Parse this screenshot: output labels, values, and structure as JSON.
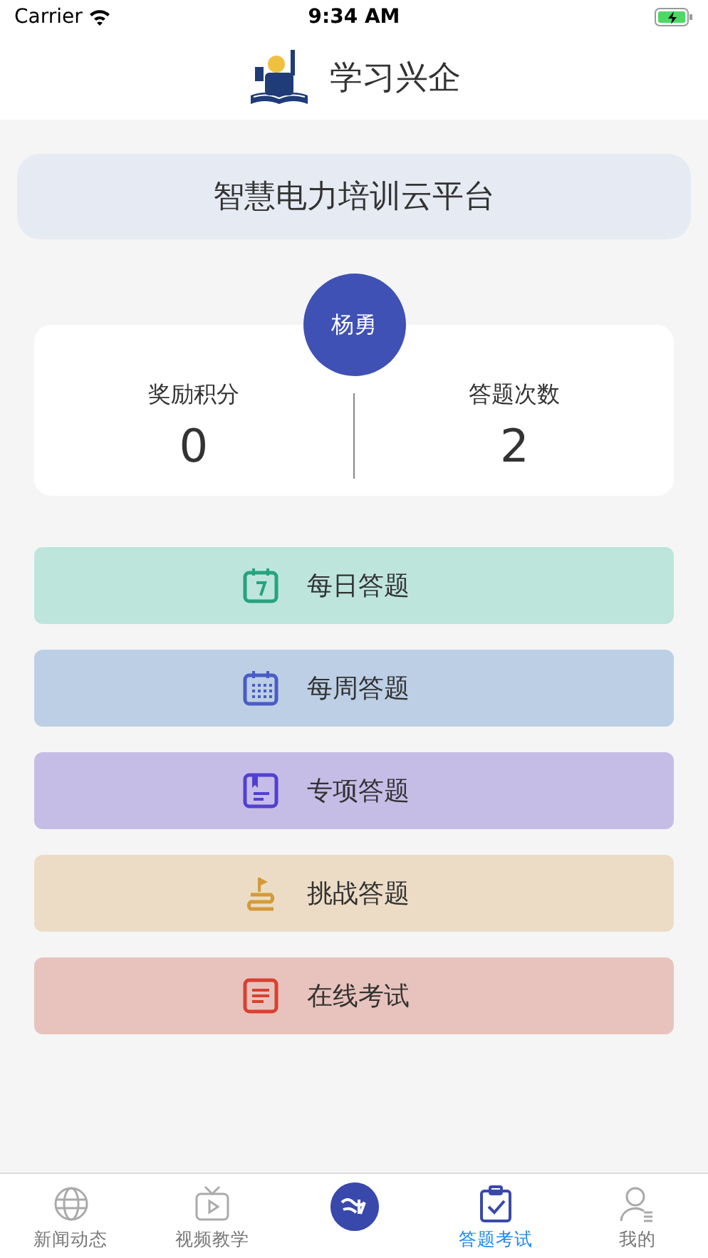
{
  "status_bar": {
    "carrier": "Carrier",
    "time": "9:34 AM"
  },
  "header": {
    "title": "学习兴企"
  },
  "banner": {
    "title": "智慧电力培训云平台"
  },
  "profile": {
    "name": "杨勇",
    "stats": [
      {
        "label": "奖励积分",
        "value": "0"
      },
      {
        "label": "答题次数",
        "value": "2"
      }
    ]
  },
  "menu": [
    {
      "label": "每日答题",
      "kind": "day",
      "color": "#bde5dc"
    },
    {
      "label": "每周答题",
      "kind": "week",
      "color": "#bccfe5"
    },
    {
      "label": "专项答题",
      "kind": "book",
      "color": "#c5bde6"
    },
    {
      "label": "挑战答题",
      "kind": "flag",
      "color": "#ecdcc6"
    },
    {
      "label": "在线考试",
      "kind": "doc",
      "color": "#e8c3bd"
    }
  ],
  "tabs": [
    {
      "label": "新闻动态",
      "kind": "globe",
      "selected": false
    },
    {
      "label": "视频教学",
      "kind": "tv",
      "selected": false
    },
    {
      "kind": "logo",
      "selected": false
    },
    {
      "label": "答题考试",
      "kind": "clipboard",
      "selected": true
    },
    {
      "label": "我的",
      "kind": "person",
      "selected": false
    }
  ]
}
